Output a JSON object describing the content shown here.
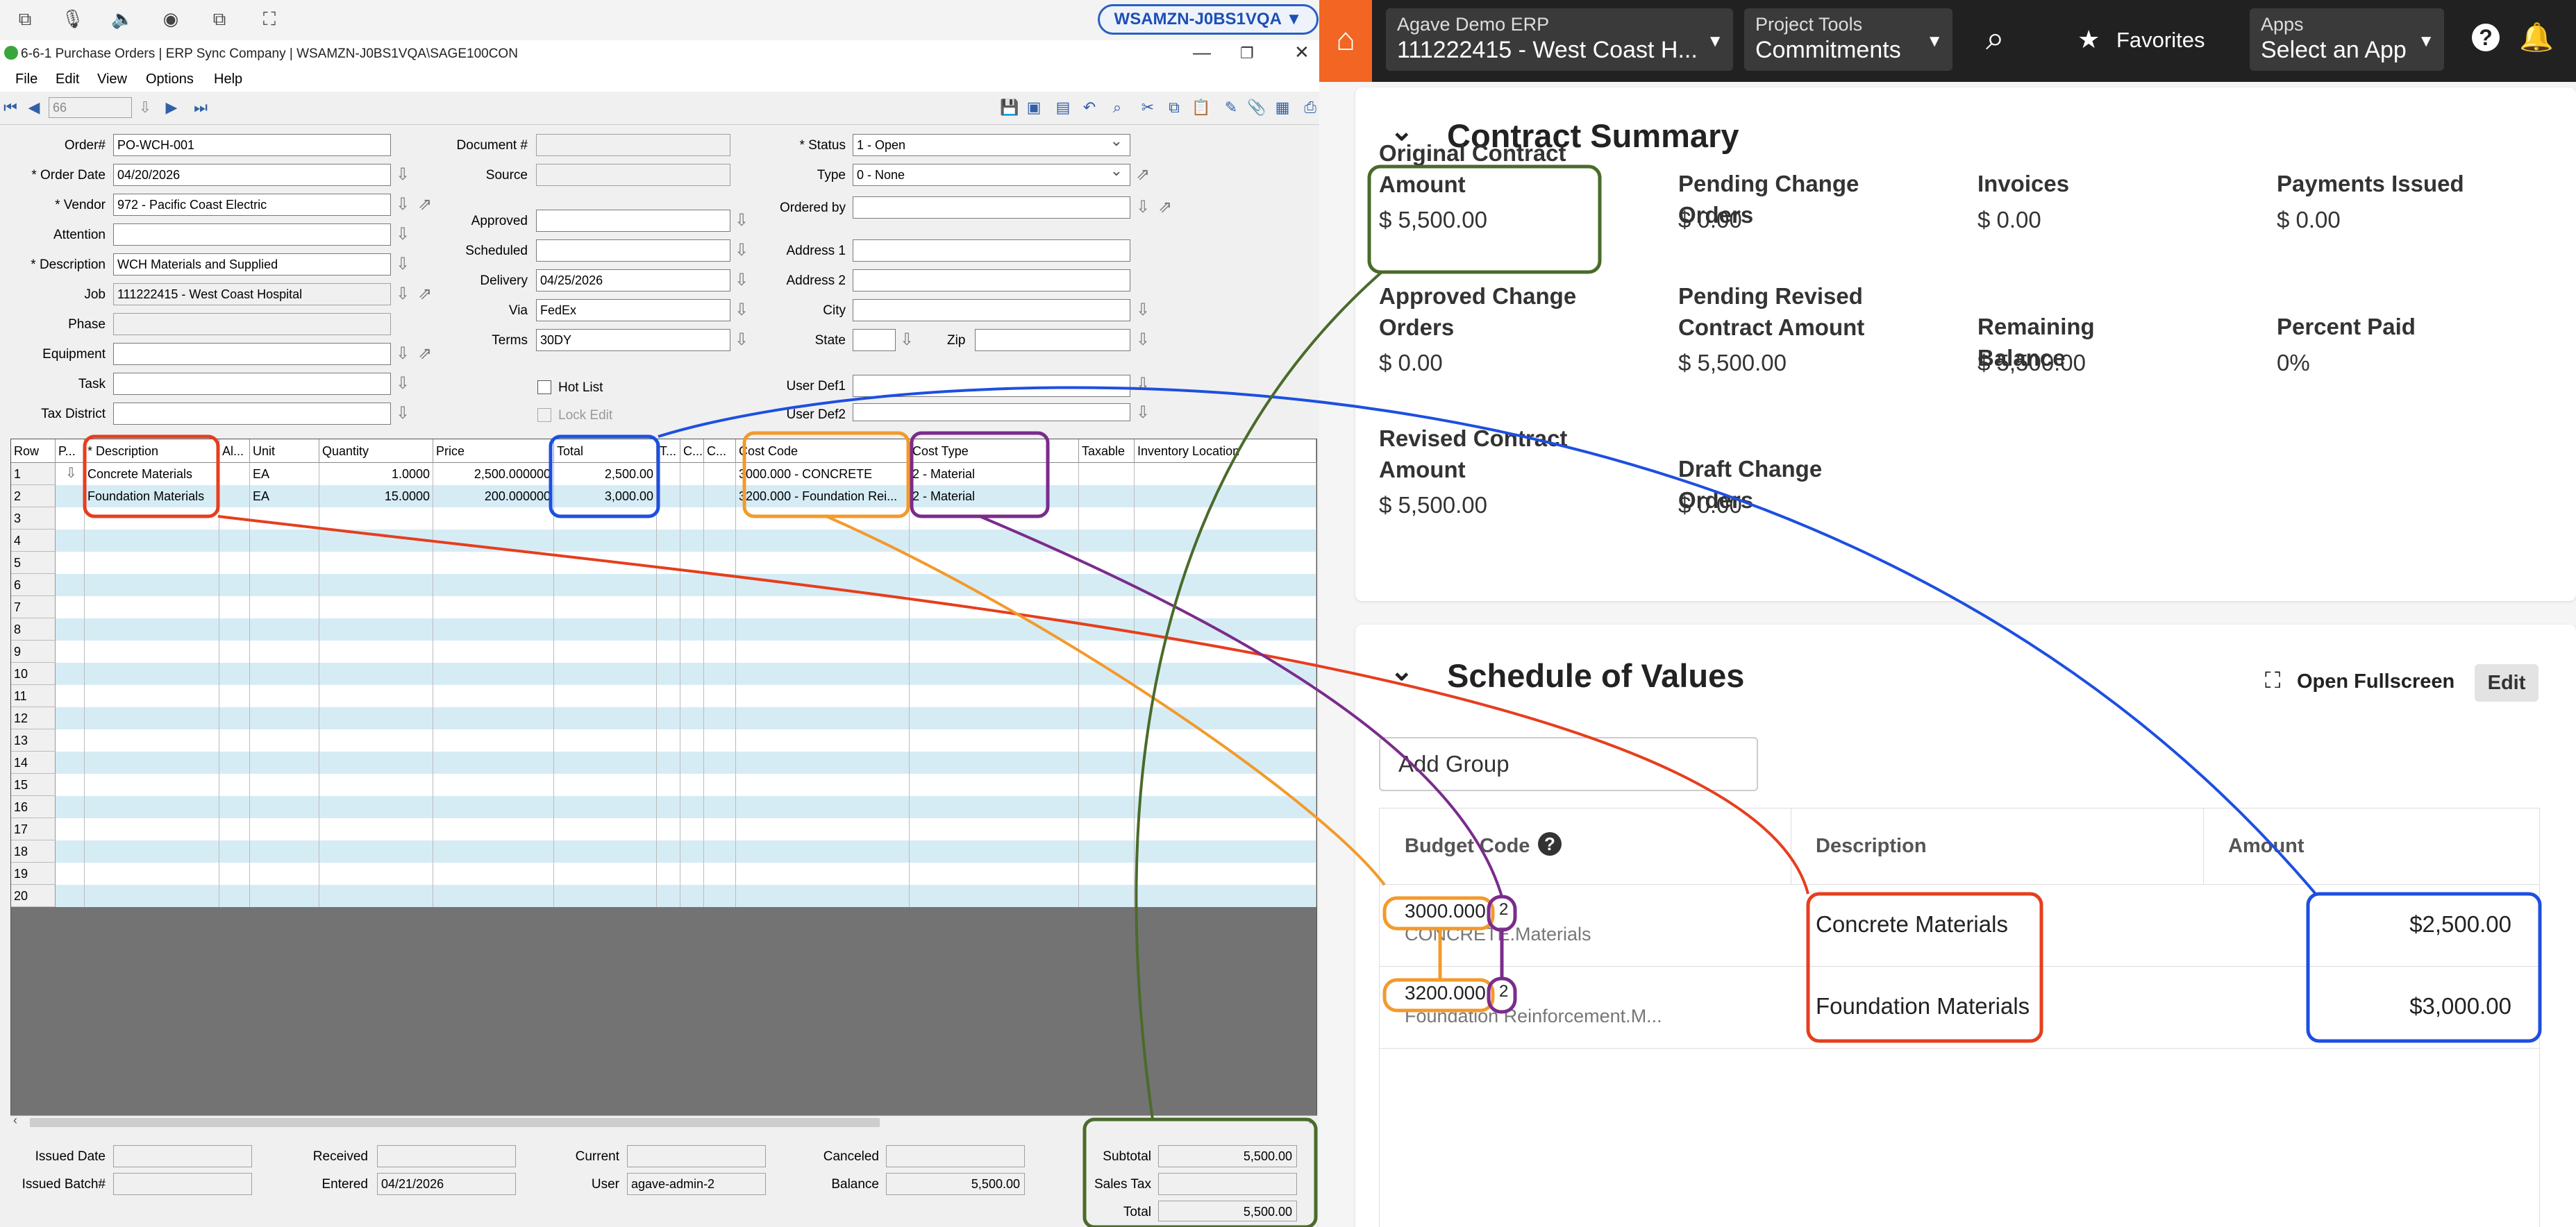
{
  "rdp": {
    "pill": "WSAMZN-J0BS1VQA ▼"
  },
  "sage": {
    "window_title": "6-6-1 Purchase Orders | ERP Sync Company | WSAMZN-J0BS1VQA\\SAGE100CON",
    "menu": [
      "File",
      "Edit",
      "View",
      "Options",
      "Help"
    ],
    "record_no": "66",
    "header_fields": {
      "order_label": "Order#",
      "order": "PO-WCH-001",
      "order_date_label": "* Order Date",
      "order_date": "04/20/2026",
      "vendor_label": "* Vendor",
      "vendor": "972 - Pacific Coast Electric",
      "attention_label": "Attention",
      "attention": "",
      "description_label": "* Description",
      "description": "WCH Materials and Supplied",
      "job_label": "Job",
      "job": "111222415 - West Coast Hospital",
      "phase_label": "Phase",
      "equipment_label": "Equipment",
      "task_label": "Task",
      "tax_district_label": "Tax District",
      "document_label": "Document #",
      "source_label": "Source",
      "approved_label": "Approved",
      "scheduled_label": "Scheduled",
      "delivery_label": "Delivery",
      "delivery": "04/25/2026",
      "via_label": "Via",
      "via": "FedEx",
      "terms_label": "Terms",
      "terms": "30DY",
      "hot_list_label": "Hot List",
      "lock_edit_label": "Lock Edit",
      "status_label": "* Status",
      "status": "1 - Open",
      "type_label": "Type",
      "type": "0 - None",
      "ordered_by_label": "Ordered by",
      "address1_label": "Address 1",
      "address2_label": "Address 2",
      "city_label": "City",
      "state_label": "State",
      "zip_label": "Zip",
      "userdef1_label": "User Def1",
      "userdef2_label": "User Def2"
    },
    "grid": {
      "headers": [
        "Row",
        "P...",
        "* Description",
        "Al...",
        "Unit",
        "Quantity",
        "Price",
        "Total",
        "T...",
        "C...",
        "C...",
        "Cost Code",
        "Cost Type",
        "Taxable",
        "Inventory Location"
      ],
      "rows": [
        {
          "row": "1",
          "description": "Concrete Materials",
          "unit": "EA",
          "quantity": "1.0000",
          "price": "2,500.000000",
          "total": "2,500.00",
          "cost_code": "3000.000 - CONCRETE",
          "cost_type": "2 - Material"
        },
        {
          "row": "2",
          "description": "Foundation Materials",
          "unit": "EA",
          "quantity": "15.0000",
          "price": "200.000000",
          "total": "3,000.00",
          "cost_code": "3200.000 - Foundation Rei...",
          "cost_type": "2 - Material"
        },
        {
          "row": "3"
        },
        {
          "row": "4"
        },
        {
          "row": "5"
        },
        {
          "row": "6"
        },
        {
          "row": "7"
        },
        {
          "row": "8"
        },
        {
          "row": "9"
        },
        {
          "row": "10"
        },
        {
          "row": "11"
        },
        {
          "row": "12"
        },
        {
          "row": "13"
        },
        {
          "row": "14"
        },
        {
          "row": "15"
        },
        {
          "row": "16"
        },
        {
          "row": "17"
        },
        {
          "row": "18"
        },
        {
          "row": "19"
        },
        {
          "row": "20"
        }
      ]
    },
    "footer": {
      "issued_date_label": "Issued Date",
      "issued_batch_label": "Issued Batch#",
      "received_label": "Received",
      "entered_label": "Entered",
      "entered": "04/21/2026",
      "current_label": "Current",
      "user_label": "User",
      "user": "agave-admin-2",
      "canceled_label": "Canceled",
      "balance_label": "Balance",
      "balance": "5,500.00",
      "subtotal_label": "Subtotal",
      "subtotal": "5,500.00",
      "sales_tax_label": "Sales Tax",
      "total_label": "Total",
      "total": "5,500.00"
    }
  },
  "agave": {
    "nav": {
      "erp_small": "Agave Demo ERP",
      "erp_large": "111222415 - West Coast H...",
      "tools_small": "Project Tools",
      "tools_large": "Commitments",
      "favorites": "Favorites",
      "apps_small": "Apps",
      "apps_large": "Select an App"
    },
    "contract_summary": {
      "title": "Contract Summary",
      "items": [
        {
          "label": "Original Contract Amount",
          "value": "$ 5,500.00"
        },
        {
          "label": "Pending Change Orders",
          "value": "$ 0.00"
        },
        {
          "label": "Invoices",
          "value": "$ 0.00"
        },
        {
          "label": "Payments Issued",
          "value": "$ 0.00"
        },
        {
          "label": "Approved Change Orders",
          "value": "$ 0.00"
        },
        {
          "label": "Pending Revised Contract Amount",
          "value": "$ 5,500.00"
        },
        {
          "label": "Remaining Balance",
          "value": "$ 5,500.00"
        },
        {
          "label": "Percent Paid",
          "value": "0%"
        },
        {
          "label": "Revised Contract Amount",
          "value": "$ 5,500.00"
        },
        {
          "label": "Draft Change Orders",
          "value": "$ 0.00"
        }
      ]
    },
    "sov": {
      "title": "Schedule of Values",
      "open_fullscreen": "Open Fullscreen",
      "edit": "Edit",
      "add_group_placeholder": "Add Group",
      "col_budget_code": "Budget Code",
      "col_description": "Description",
      "col_amount": "Amount",
      "rows": [
        {
          "code": "3000.000",
          "type": "2",
          "sub": "CONCRETE.Materials",
          "description": "Concrete Materials",
          "amount": "$2,500.00"
        },
        {
          "code": "3200.000",
          "type": "2",
          "sub": "Foundation Reinforcement.M...",
          "description": "Foundation Materials",
          "amount": "$3,000.00"
        }
      ]
    }
  },
  "colors": {
    "red": "#e63e1e",
    "blue": "#1d4fe0",
    "orange": "#f39a2b",
    "purple": "#7b2b8c",
    "green": "#4a6b2a",
    "agave_orange": "#f26522"
  }
}
